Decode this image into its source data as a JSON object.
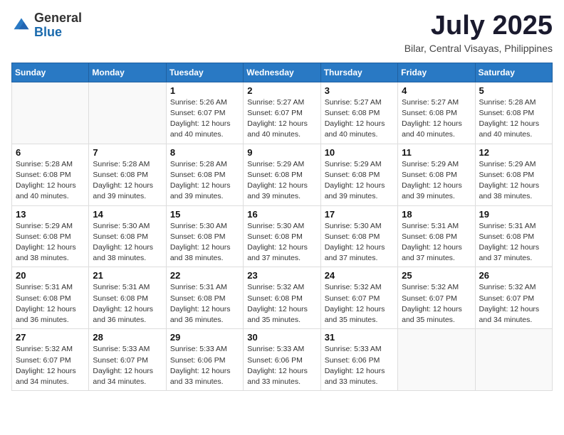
{
  "logo": {
    "general": "General",
    "blue": "Blue"
  },
  "header": {
    "month": "July 2025",
    "location": "Bilar, Central Visayas, Philippines"
  },
  "weekdays": [
    "Sunday",
    "Monday",
    "Tuesday",
    "Wednesday",
    "Thursday",
    "Friday",
    "Saturday"
  ],
  "weeks": [
    [
      null,
      null,
      {
        "day": 1,
        "sunrise": "5:26 AM",
        "sunset": "6:07 PM",
        "daylight": "12 hours and 40 minutes."
      },
      {
        "day": 2,
        "sunrise": "5:27 AM",
        "sunset": "6:07 PM",
        "daylight": "12 hours and 40 minutes."
      },
      {
        "day": 3,
        "sunrise": "5:27 AM",
        "sunset": "6:08 PM",
        "daylight": "12 hours and 40 minutes."
      },
      {
        "day": 4,
        "sunrise": "5:27 AM",
        "sunset": "6:08 PM",
        "daylight": "12 hours and 40 minutes."
      },
      {
        "day": 5,
        "sunrise": "5:28 AM",
        "sunset": "6:08 PM",
        "daylight": "12 hours and 40 minutes."
      }
    ],
    [
      {
        "day": 6,
        "sunrise": "5:28 AM",
        "sunset": "6:08 PM",
        "daylight": "12 hours and 40 minutes."
      },
      {
        "day": 7,
        "sunrise": "5:28 AM",
        "sunset": "6:08 PM",
        "daylight": "12 hours and 39 minutes."
      },
      {
        "day": 8,
        "sunrise": "5:28 AM",
        "sunset": "6:08 PM",
        "daylight": "12 hours and 39 minutes."
      },
      {
        "day": 9,
        "sunrise": "5:29 AM",
        "sunset": "6:08 PM",
        "daylight": "12 hours and 39 minutes."
      },
      {
        "day": 10,
        "sunrise": "5:29 AM",
        "sunset": "6:08 PM",
        "daylight": "12 hours and 39 minutes."
      },
      {
        "day": 11,
        "sunrise": "5:29 AM",
        "sunset": "6:08 PM",
        "daylight": "12 hours and 39 minutes."
      },
      {
        "day": 12,
        "sunrise": "5:29 AM",
        "sunset": "6:08 PM",
        "daylight": "12 hours and 38 minutes."
      }
    ],
    [
      {
        "day": 13,
        "sunrise": "5:29 AM",
        "sunset": "6:08 PM",
        "daylight": "12 hours and 38 minutes."
      },
      {
        "day": 14,
        "sunrise": "5:30 AM",
        "sunset": "6:08 PM",
        "daylight": "12 hours and 38 minutes."
      },
      {
        "day": 15,
        "sunrise": "5:30 AM",
        "sunset": "6:08 PM",
        "daylight": "12 hours and 38 minutes."
      },
      {
        "day": 16,
        "sunrise": "5:30 AM",
        "sunset": "6:08 PM",
        "daylight": "12 hours and 37 minutes."
      },
      {
        "day": 17,
        "sunrise": "5:30 AM",
        "sunset": "6:08 PM",
        "daylight": "12 hours and 37 minutes."
      },
      {
        "day": 18,
        "sunrise": "5:31 AM",
        "sunset": "6:08 PM",
        "daylight": "12 hours and 37 minutes."
      },
      {
        "day": 19,
        "sunrise": "5:31 AM",
        "sunset": "6:08 PM",
        "daylight": "12 hours and 37 minutes."
      }
    ],
    [
      {
        "day": 20,
        "sunrise": "5:31 AM",
        "sunset": "6:08 PM",
        "daylight": "12 hours and 36 minutes."
      },
      {
        "day": 21,
        "sunrise": "5:31 AM",
        "sunset": "6:08 PM",
        "daylight": "12 hours and 36 minutes."
      },
      {
        "day": 22,
        "sunrise": "5:31 AM",
        "sunset": "6:08 PM",
        "daylight": "12 hours and 36 minutes."
      },
      {
        "day": 23,
        "sunrise": "5:32 AM",
        "sunset": "6:08 PM",
        "daylight": "12 hours and 35 minutes."
      },
      {
        "day": 24,
        "sunrise": "5:32 AM",
        "sunset": "6:07 PM",
        "daylight": "12 hours and 35 minutes."
      },
      {
        "day": 25,
        "sunrise": "5:32 AM",
        "sunset": "6:07 PM",
        "daylight": "12 hours and 35 minutes."
      },
      {
        "day": 26,
        "sunrise": "5:32 AM",
        "sunset": "6:07 PM",
        "daylight": "12 hours and 34 minutes."
      }
    ],
    [
      {
        "day": 27,
        "sunrise": "5:32 AM",
        "sunset": "6:07 PM",
        "daylight": "12 hours and 34 minutes."
      },
      {
        "day": 28,
        "sunrise": "5:33 AM",
        "sunset": "6:07 PM",
        "daylight": "12 hours and 34 minutes."
      },
      {
        "day": 29,
        "sunrise": "5:33 AM",
        "sunset": "6:06 PM",
        "daylight": "12 hours and 33 minutes."
      },
      {
        "day": 30,
        "sunrise": "5:33 AM",
        "sunset": "6:06 PM",
        "daylight": "12 hours and 33 minutes."
      },
      {
        "day": 31,
        "sunrise": "5:33 AM",
        "sunset": "6:06 PM",
        "daylight": "12 hours and 33 minutes."
      },
      null,
      null
    ]
  ],
  "labels": {
    "sunrise": "Sunrise:",
    "sunset": "Sunset:",
    "daylight": "Daylight:"
  }
}
